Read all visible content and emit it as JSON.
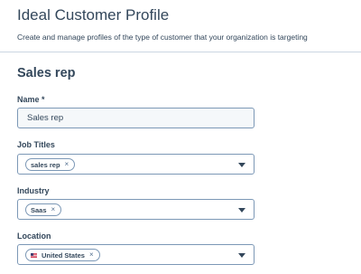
{
  "header": {
    "title": "Ideal Customer Profile",
    "description": "Create and manage profiles of the type of customer that your organization is targeting"
  },
  "section": {
    "title": "Sales rep"
  },
  "fields": {
    "name": {
      "label": "Name *",
      "value": "Sales rep"
    },
    "job_titles": {
      "label": "Job Titles",
      "chip": "sales rep",
      "chip_remove": "×"
    },
    "industry": {
      "label": "Industry",
      "chip": "Saas",
      "chip_remove": "×"
    },
    "location": {
      "label": "Location",
      "chip": "United States",
      "chip_remove": "×",
      "chip_icon": "us-flag-icon"
    }
  },
  "colors": {
    "text": "#33475b",
    "border": "#7c98b6",
    "divider": "#cbd6e2",
    "input_bg": "#f5f8fa"
  }
}
